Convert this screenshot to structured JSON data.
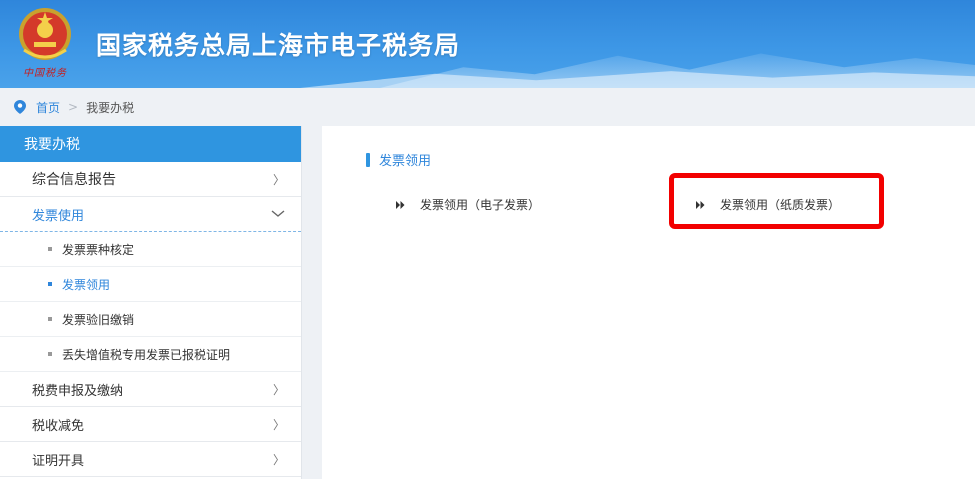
{
  "header": {
    "title": "国家税务总局上海市电子税务局",
    "emblem_caption": "中国税务"
  },
  "breadcrumb": {
    "home": "首页",
    "separator": ">",
    "current": "我要办税"
  },
  "sidebar": {
    "header": "我要办税",
    "menu": [
      {
        "label": "综合信息报告",
        "chevron": "〉"
      },
      {
        "label": "发票使用",
        "expanded": true
      },
      {
        "label": "税费申报及缴纳",
        "chevron": "〉"
      },
      {
        "label": "税收减免",
        "chevron": "〉"
      },
      {
        "label": "证明开具",
        "chevron": "〉"
      }
    ],
    "sub_items": [
      {
        "label": "发票票种核定"
      },
      {
        "label": "发票领用",
        "active": true
      },
      {
        "label": "发票验旧缴销"
      },
      {
        "label": "丢失增值税专用发票已报税证明"
      }
    ]
  },
  "main": {
    "section_title": "发票领用",
    "links": [
      {
        "label": "发票领用（电子发票）"
      },
      {
        "label": "发票领用（纸质发票）",
        "highlighted": true
      }
    ]
  },
  "colors": {
    "brand_blue": "#2f86db",
    "sidebar_header": "#2f95e0",
    "highlight_red": "#f20000"
  },
  "icons": {
    "emblem": "tax-emblem-icon",
    "location": "location-pin-icon",
    "link_marker": "double-arrow-icon"
  }
}
